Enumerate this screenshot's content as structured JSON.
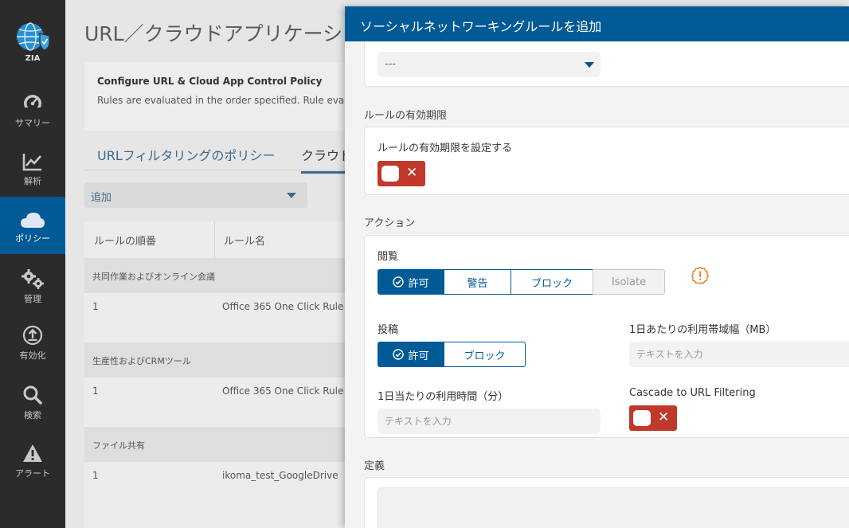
{
  "nav": {
    "logo_label": "ZIA",
    "items": [
      {
        "label": "サマリー",
        "icon": "gauge-icon"
      },
      {
        "label": "解析",
        "icon": "chart-line-icon"
      },
      {
        "label": "ポリシー",
        "icon": "cloud-icon"
      },
      {
        "label": "管理",
        "icon": "gears-icon"
      },
      {
        "label": "有効化",
        "icon": "upload-icon"
      },
      {
        "label": "検索",
        "icon": "search-icon"
      },
      {
        "label": "アラート",
        "icon": "alert-icon"
      }
    ]
  },
  "background": {
    "title": "URL／クラウドアプリケーショ",
    "card_heading": "Configure URL & Cloud App Control Policy",
    "card_text": "Rules are evaluated in the order specified. Rule eva",
    "tab1": "URLフィルタリングのポリシー",
    "tab2": "クラウド",
    "add_dropdown": "追加",
    "table": {
      "col1": "ルールの順番",
      "col2": "ルール名",
      "groups": [
        {
          "name": "共同作業およびオンライン会議",
          "order": "1",
          "rule": "Office 365 One Click Rule"
        },
        {
          "name": "生産性およびCRMツール",
          "order": "1",
          "rule": "Office 365 One Click Rule"
        },
        {
          "name": "ファイル共有",
          "order": "1",
          "rule": "ikoma_test_GoogleDrive"
        }
      ]
    }
  },
  "panel": {
    "title": "ソーシャルネットワーキングルールを追加",
    "top_select_value": "---",
    "expiry_section": "ルールの有効期限",
    "expiry_label": "ルールの有効期限を設定する",
    "action_section": "アクション",
    "view_label": "閲覧",
    "view_options": [
      "許可",
      "警告",
      "ブロック",
      "Isolate"
    ],
    "post_label": "投稿",
    "post_options": [
      "許可",
      "ブロック"
    ],
    "bandwidth_label": "1日あたりの利用帯域幅（MB）",
    "bandwidth_placeholder": "テキストを入力",
    "time_label": "1日当たりの利用時間（分）",
    "time_placeholder": "テキストを入力",
    "cascade_label": "Cascade to URL Filtering",
    "definition_section": "定義"
  },
  "colors": {
    "primary": "#005a96",
    "toggle_off": "#c0392b",
    "warning": "#e67e22"
  }
}
